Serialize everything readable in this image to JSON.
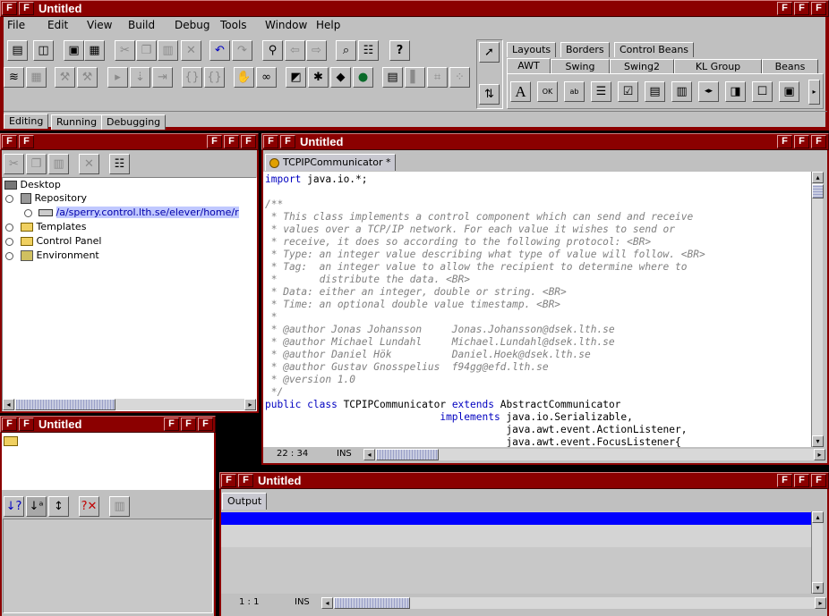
{
  "main_window": {
    "title": "Untitled"
  },
  "menu": [
    {
      "label": "File"
    },
    {
      "label": "Edit"
    },
    {
      "label": "View"
    },
    {
      "label": "Build"
    },
    {
      "label": "Debug"
    },
    {
      "label": "Tools"
    },
    {
      "label": "Window"
    },
    {
      "label": "Help"
    }
  ],
  "workspace_tabs": [
    "Editing",
    "Running",
    "Debugging"
  ],
  "palette": {
    "row1_tabs": [
      "Layouts",
      "Borders",
      "Control Beans"
    ],
    "row2_tabs": [
      "AWT",
      "Swing",
      "Swing2",
      "KL Group",
      "Beans"
    ],
    "selected_tab": "AWT",
    "awt_ok_label": "OK"
  },
  "explorer": {
    "title": "Untitled",
    "tree": [
      {
        "label": "Desktop"
      },
      {
        "label": "Repository"
      },
      {
        "label": "/a/sperry.control.lth.se/elever/home/r"
      },
      {
        "label": "Templates"
      },
      {
        "label": "Control Panel"
      },
      {
        "label": "Environment"
      }
    ]
  },
  "properties": {
    "title": "Untitled"
  },
  "editor": {
    "title": "Untitled",
    "tab_label": "TCPIPCommunicator *",
    "lines": [
      [
        {
          "t": "import",
          "c": "kw"
        },
        {
          "t": " java.io.*;",
          "c": ""
        }
      ],
      [
        {
          "t": "",
          "c": ""
        }
      ],
      [
        {
          "t": "/**",
          "c": "cm"
        }
      ],
      [
        {
          "t": " * This class implements a control component which can send and receive",
          "c": "cm"
        }
      ],
      [
        {
          "t": " * values over a TCP/IP network. For each value it wishes to send or",
          "c": "cm"
        }
      ],
      [
        {
          "t": " * receive, it does so according to the following protocol: <BR>",
          "c": "cm"
        }
      ],
      [
        {
          "t": " * Type: an integer value describing what type of value will follow. <BR>",
          "c": "cm"
        }
      ],
      [
        {
          "t": " * Tag:  an integer value to allow the recipient to determine where to",
          "c": "cm"
        }
      ],
      [
        {
          "t": " *       distribute the data. <BR>",
          "c": "cm"
        }
      ],
      [
        {
          "t": " * Data: either an integer, double or string. <BR>",
          "c": "cm"
        }
      ],
      [
        {
          "t": " * Time: an optional double value timestamp. <BR>",
          "c": "cm"
        }
      ],
      [
        {
          "t": " *",
          "c": "cm"
        }
      ],
      [
        {
          "t": " * @author Jonas Johansson     Jonas.Johansson@dsek.lth.se",
          "c": "cm"
        }
      ],
      [
        {
          "t": " * @author Michael Lundahl     Michael.Lundahl@dsek.lth.se",
          "c": "cm"
        }
      ],
      [
        {
          "t": " * @author Daniel Hök          Daniel.Hoek@dsek.lth.se",
          "c": "cm"
        }
      ],
      [
        {
          "t": " * @author Gustav Gnosspelius  f94gg@efd.lth.se",
          "c": "cm"
        }
      ],
      [
        {
          "t": " * @version 1.0",
          "c": "cm"
        }
      ],
      [
        {
          "t": " */",
          "c": "cm"
        }
      ],
      [
        {
          "t": "public class",
          "c": "kw"
        },
        {
          "t": " TCPIPCommunicator ",
          "c": ""
        },
        {
          "t": "extends",
          "c": "kw"
        },
        {
          "t": " AbstractCommunicator",
          "c": ""
        }
      ],
      [
        {
          "t": "                             ",
          "c": ""
        },
        {
          "t": "implements",
          "c": "kw"
        },
        {
          "t": " java.io.Serializable,",
          "c": ""
        }
      ],
      [
        {
          "t": "                                        java.awt.event.ActionListener,",
          "c": ""
        }
      ],
      [
        {
          "t": "                                        java.awt.event.FocusListener{",
          "c": ""
        }
      ]
    ],
    "status_pos": "22 : 34",
    "status_mode": "INS"
  },
  "output": {
    "title": "Untitled",
    "tab_label": "Output",
    "status_pos": "1 : 1",
    "status_mode": "INS"
  },
  "colors": {
    "titlebar": "#8b0000",
    "keyword": "#0000c0",
    "comment": "#808080",
    "selection": "#0000ff"
  }
}
